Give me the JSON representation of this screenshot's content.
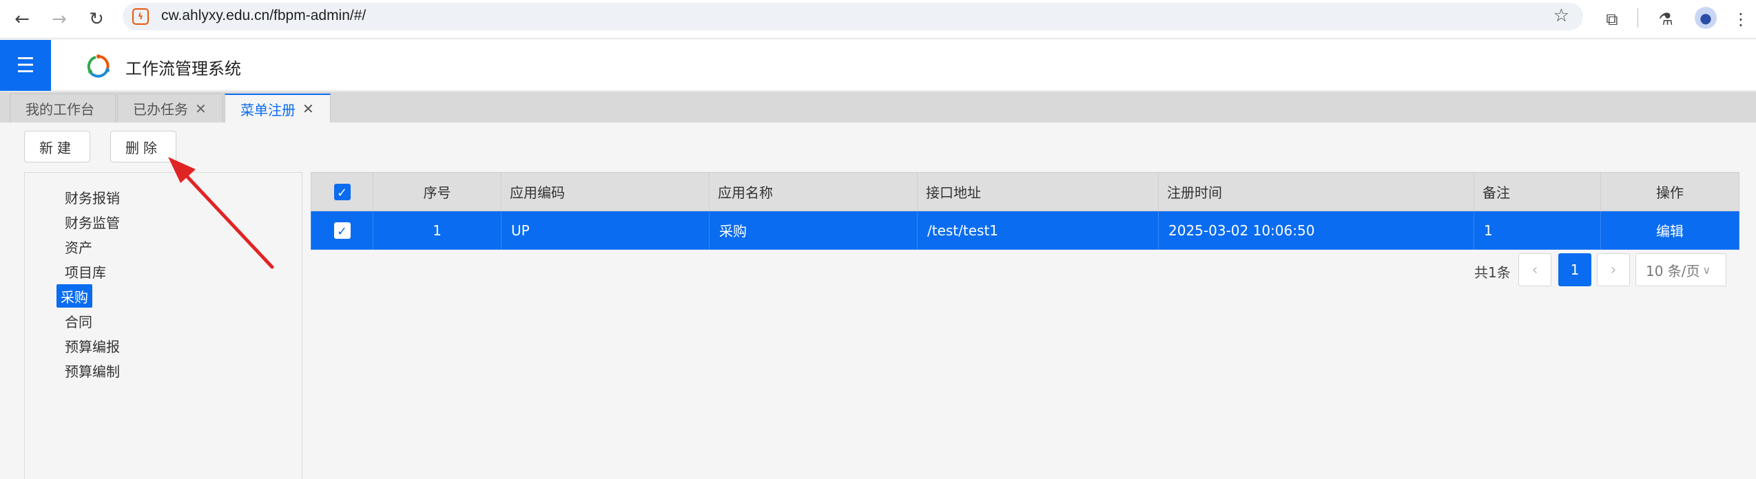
{
  "browser": {
    "url": "cw.ahlyxy.edu.cn/fbpm-admin/#/",
    "back_icon": "arrow-left-icon",
    "forward_icon": "arrow-right-icon",
    "reload_icon": "reload-icon"
  },
  "app": {
    "title": "工作流管理系统",
    "menu_icon": "hamburger-icon",
    "brand_color": "#0a6cf0"
  },
  "tabs": [
    {
      "label": "我的工作台",
      "closable": false,
      "active": false
    },
    {
      "label": "已办任务",
      "closable": true,
      "active": false
    },
    {
      "label": "菜单注册",
      "closable": true,
      "active": true
    }
  ],
  "toolbar": {
    "new_label": "新建",
    "delete_label": "删除"
  },
  "tree": {
    "items": [
      "财务报销",
      "财务监管",
      "资产",
      "项目库",
      "采购",
      "合同",
      "预算编报",
      "预算编制"
    ],
    "selected": "采购"
  },
  "table": {
    "headers": [
      "序号",
      "应用编码",
      "应用名称",
      "接口地址",
      "注册时间",
      "备注",
      "操作"
    ],
    "rows": [
      {
        "index": "1",
        "code": "UP",
        "name": "采购",
        "url": "/test/test1",
        "time": "2025-03-02 10:06:50",
        "remark": "1",
        "action": "编辑"
      }
    ]
  },
  "pager": {
    "total": "共1条",
    "current": "1",
    "page_size": "10 条/页",
    "prev": "‹",
    "next": "›"
  },
  "close_glyph": "✕"
}
